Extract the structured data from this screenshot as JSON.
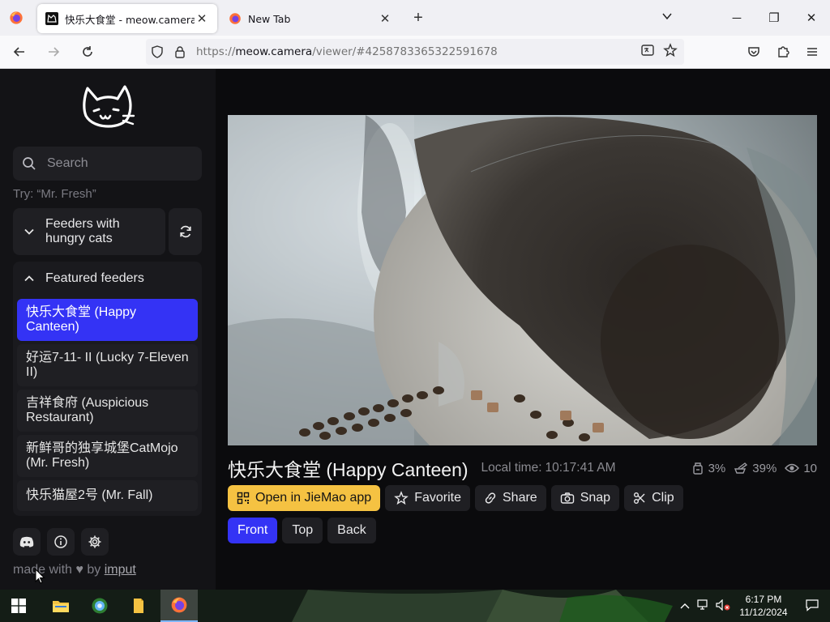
{
  "browser": {
    "tabs": [
      {
        "title": "快乐大食堂 - meow.camera",
        "active": true
      },
      {
        "title": "New Tab",
        "active": false
      }
    ],
    "url_prefix": "https://",
    "url_host": "meow.camera",
    "url_path": "/viewer/#4258783365322591678"
  },
  "sidebar": {
    "search_placeholder": "Search",
    "try_hint": "Try: “Mr. Fresh”",
    "group1_title": "Feeders with hungry cats",
    "group2_title": "Featured feeders",
    "feeders": [
      {
        "label": "快乐大食堂 (Happy Canteen)",
        "active": true
      },
      {
        "label": "好运7-11- II (Lucky 7-Eleven II)",
        "active": false
      },
      {
        "label": "吉祥食府 (Auspicious Restaurant)",
        "active": false
      },
      {
        "label": "新鲜哥的独享城堡CatMojo (Mr. Fresh)",
        "active": false
      },
      {
        "label": "快乐猫屋2号 (Mr. Fall)",
        "active": false
      }
    ],
    "made_with_prefix": "made with",
    "made_with_by": "by",
    "made_with_author": "imput"
  },
  "viewer": {
    "feeder_title": "快乐大食堂 (Happy Canteen)",
    "local_time_label": "Local time:",
    "local_time_value": "10:17:41 AM",
    "stats": {
      "food_level": "3%",
      "battery_level": "39%",
      "viewers": "10"
    },
    "actions": {
      "open_app": "Open in JieMao app",
      "favorite": "Favorite",
      "share": "Share",
      "snap": "Snap",
      "clip": "Clip"
    },
    "views": [
      {
        "label": "Front",
        "active": true
      },
      {
        "label": "Top",
        "active": false
      },
      {
        "label": "Back",
        "active": false
      }
    ]
  },
  "taskbar": {
    "time": "6:17 PM",
    "date": "11/12/2024"
  },
  "colors": {
    "accent": "#3433f5",
    "yellow": "#f5c242",
    "sidebar_bg": "#131316"
  }
}
